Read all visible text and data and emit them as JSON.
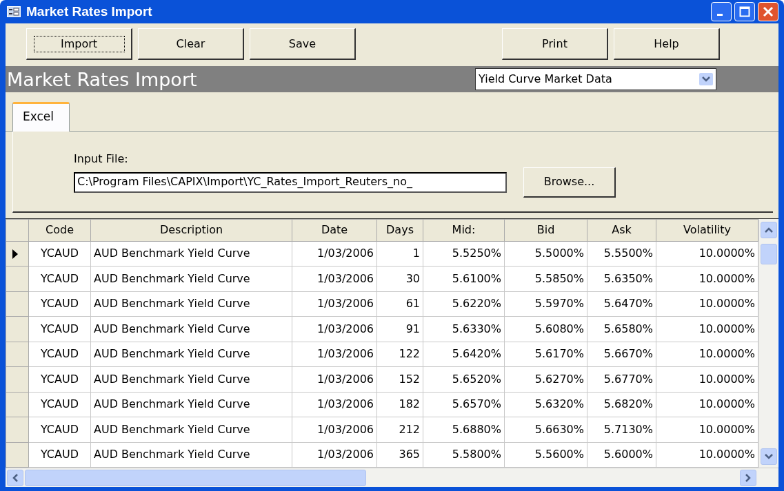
{
  "window": {
    "title": "Market Rates Import"
  },
  "toolbar": {
    "buttons": [
      {
        "label": "Import",
        "focused": true
      },
      {
        "label": "Clear",
        "focused": false
      },
      {
        "label": "Save",
        "focused": false
      },
      {
        "label": "Print",
        "focused": false
      },
      {
        "label": "Help",
        "focused": false
      }
    ]
  },
  "header": {
    "title": "Market Rates Import",
    "dropdown": {
      "value": "Yield Curve Market Data"
    }
  },
  "tabs": [
    {
      "label": "Excel",
      "selected": true
    }
  ],
  "input_file": {
    "label": "Input File:",
    "value": "C:\\Program Files\\CAPIX\\Import\\YC_Rates_Import_Reuters_no_",
    "browse": "Browse..."
  },
  "table": {
    "columns": [
      "Code",
      "Description",
      "Date",
      "Days",
      "Mid:",
      "Bid",
      "Ask",
      "Volatility"
    ],
    "rows": [
      {
        "current": true,
        "cells": [
          "YCAUD",
          "AUD Benchmark Yield Curve",
          "1/03/2006",
          "1",
          "5.5250%",
          "5.5000%",
          "5.5500%",
          "10.0000%"
        ]
      },
      {
        "current": false,
        "cells": [
          "YCAUD",
          "AUD Benchmark Yield Curve",
          "1/03/2006",
          "30",
          "5.6100%",
          "5.5850%",
          "5.6350%",
          "10.0000%"
        ]
      },
      {
        "current": false,
        "cells": [
          "YCAUD",
          "AUD Benchmark Yield Curve",
          "1/03/2006",
          "61",
          "5.6220%",
          "5.5970%",
          "5.6470%",
          "10.0000%"
        ]
      },
      {
        "current": false,
        "cells": [
          "YCAUD",
          "AUD Benchmark Yield Curve",
          "1/03/2006",
          "91",
          "5.6330%",
          "5.6080%",
          "5.6580%",
          "10.0000%"
        ]
      },
      {
        "current": false,
        "cells": [
          "YCAUD",
          "AUD Benchmark Yield Curve",
          "1/03/2006",
          "122",
          "5.6420%",
          "5.6170%",
          "5.6670%",
          "10.0000%"
        ]
      },
      {
        "current": false,
        "cells": [
          "YCAUD",
          "AUD Benchmark Yield Curve",
          "1/03/2006",
          "152",
          "5.6520%",
          "5.6270%",
          "5.6770%",
          "10.0000%"
        ]
      },
      {
        "current": false,
        "cells": [
          "YCAUD",
          "AUD Benchmark Yield Curve",
          "1/03/2006",
          "182",
          "5.6570%",
          "5.6320%",
          "5.6820%",
          "10.0000%"
        ]
      },
      {
        "current": false,
        "cells": [
          "YCAUD",
          "AUD Benchmark Yield Curve",
          "1/03/2006",
          "212",
          "5.6880%",
          "5.6630%",
          "5.7130%",
          "10.0000%"
        ]
      },
      {
        "current": false,
        "cells": [
          "YCAUD",
          "AUD Benchmark Yield Curve",
          "1/03/2006",
          "365",
          "5.5800%",
          "5.5600%",
          "5.6000%",
          "10.0000%"
        ]
      }
    ]
  }
}
